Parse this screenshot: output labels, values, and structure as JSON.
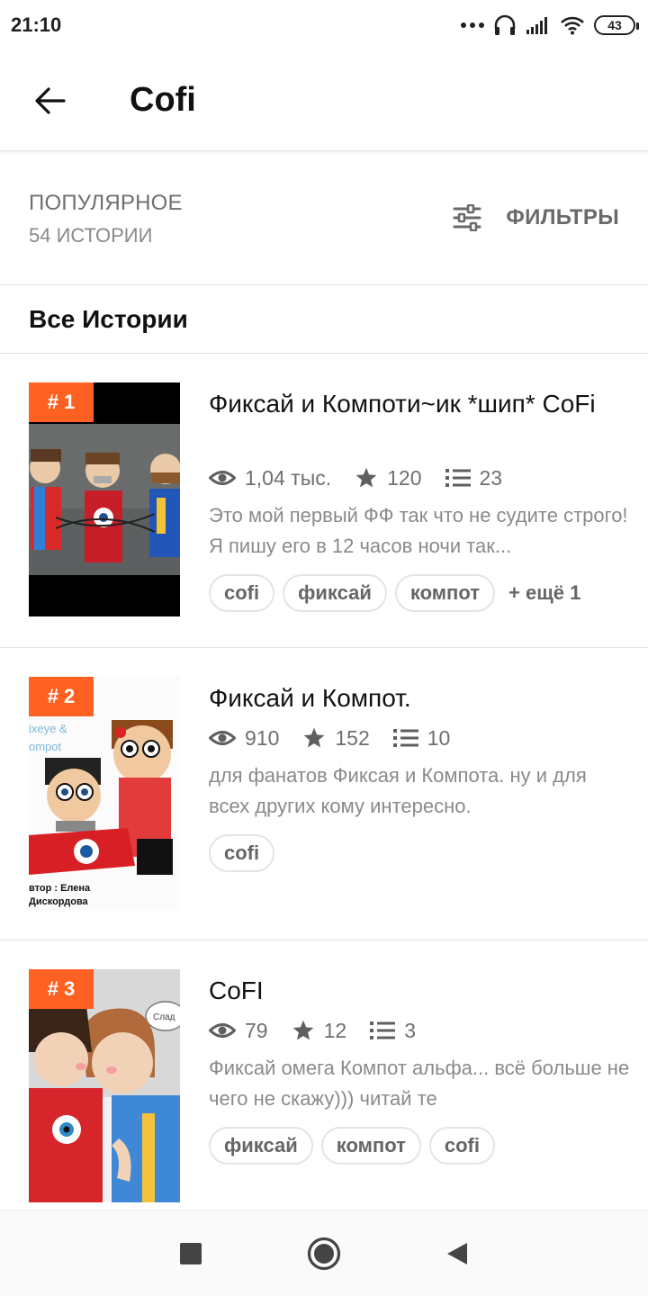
{
  "status_bar": {
    "time": "21:10",
    "battery": "43"
  },
  "app_bar": {
    "title": "Cofi"
  },
  "filter_row": {
    "sort_label": "ПОПУЛЯРНОЕ",
    "count_label": "54 ИСТОРИИ",
    "filters_label": "ФИЛЬТРЫ"
  },
  "section": {
    "title": "Все Истории"
  },
  "stories": [
    {
      "rank": "# 1",
      "title": "Фиксай и Компоти~ик *шип* CoFi",
      "views": "1,04 тыс.",
      "votes": "120",
      "parts": "23",
      "description": "Это мой первый ФФ так что не судите строго! Я пишу его в 12 часов ночи так...",
      "tags": [
        "cofi",
        "фиксай",
        "компот"
      ],
      "more_tags": "+ ещё 1"
    },
    {
      "rank": "# 2",
      "title": "Фиксай и Компот.",
      "views": "910",
      "votes": "152",
      "parts": "10",
      "description": "для фанатов Фиксая и Компота. ну и для всех других кому интересно.",
      "tags": [
        "cofi"
      ],
      "cover_text": {
        "line1": "ixeye &",
        "line2": "ompot",
        "line3": "втор : Елена",
        "line4": "Дискордова"
      }
    },
    {
      "rank": "# 3",
      "title": "CoFI",
      "views": "79",
      "votes": "12",
      "parts": "3",
      "description": "Фиксай омега Компот альфа... всё больше не чего не скажу))) читай те",
      "tags": [
        "фиксай",
        "компот",
        "cofi"
      ],
      "cover_text": {
        "bubble": "Слад"
      }
    }
  ],
  "icons": {
    "back": "arrow-left-icon",
    "filters": "sliders-icon",
    "views": "eye-icon",
    "votes": "star-icon",
    "parts": "list-icon",
    "nav": [
      "square-icon",
      "circle-icon",
      "triangle-back-icon"
    ]
  },
  "colors": {
    "accent": "#ff6122",
    "text": "#121212",
    "muted": "#6f6f6f"
  }
}
